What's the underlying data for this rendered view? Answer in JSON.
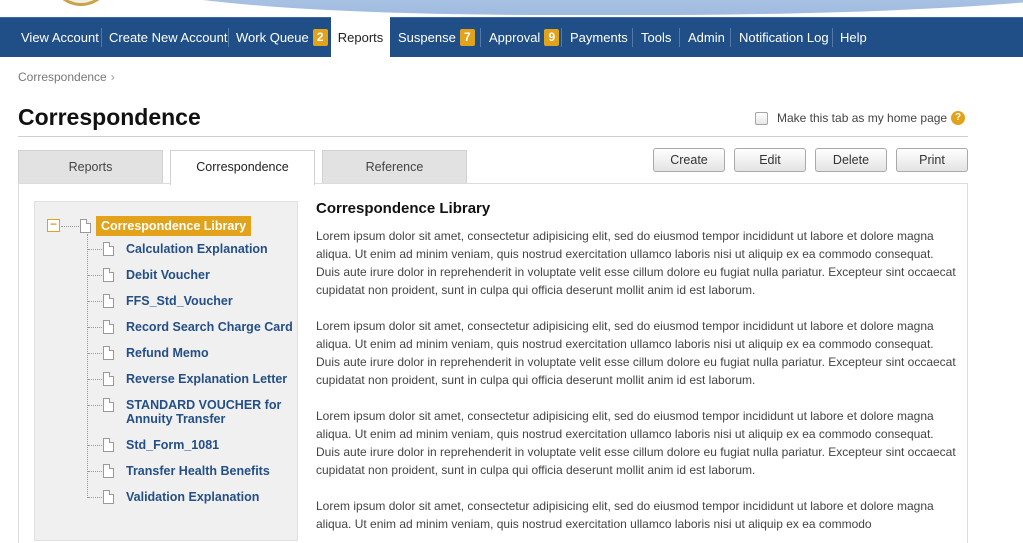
{
  "nav": {
    "items": [
      {
        "label": "View Account"
      },
      {
        "label": "Create New Account"
      },
      {
        "label": "Work Queue",
        "badge": "2"
      },
      {
        "label": "Reports"
      },
      {
        "label": "Suspense",
        "badge": "7"
      },
      {
        "label": "Approval",
        "badge": "9"
      },
      {
        "label": "Payments"
      },
      {
        "label": "Tools"
      },
      {
        "label": "Admin"
      },
      {
        "label": "Notification Log"
      },
      {
        "label": "Help"
      }
    ],
    "active": "Reports",
    "bar_color": "#1f4f86",
    "badge_color": "#e2a21a"
  },
  "breadcrumb": {
    "item": "Correspondence",
    "chevron": "›"
  },
  "page": {
    "title": "Correspondence",
    "home_toggle_label": "Make this tab as my home page",
    "help_icon": "question-circle-icon",
    "help_glyph": "?"
  },
  "tabs": [
    {
      "label": "Reports"
    },
    {
      "label": "Correspondence"
    },
    {
      "label": "Reference"
    }
  ],
  "active_tab": "Correspondence",
  "toolbar": {
    "create_label": "Create",
    "edit_label": "Edit",
    "delete_label": "Delete",
    "print_label": "Print"
  },
  "tree": {
    "collapse_glyph": "−",
    "root_label": "Correspondence Library",
    "items": [
      {
        "label": "Calculation Explanation"
      },
      {
        "label": "Debit Voucher"
      },
      {
        "label": "FFS_Std_Voucher"
      },
      {
        "label": "Record Search Charge Card"
      },
      {
        "label": "Refund Memo"
      },
      {
        "label": "Reverse Explanation Letter"
      },
      {
        "label": "STANDARD VOUCHER for Annuity Transfer"
      },
      {
        "label": "Std_Form_1081"
      },
      {
        "label": "Transfer Health Benefits"
      },
      {
        "label": "Validation Explanation"
      }
    ]
  },
  "article": {
    "title": "Correspondence Library",
    "paragraphs": [
      "Lorem ipsum dolor sit amet, consectetur adipisicing elit, sed do eiusmod tempor incididunt ut labore et dolore magna aliqua. Ut enim ad minim veniam, quis nostrud exercitation ullamco laboris nisi ut aliquip ex ea commodo consequat. Duis aute irure dolor in reprehenderit in voluptate velit esse cillum dolore eu fugiat nulla pariatur. Excepteur sint occaecat cupidatat non proident, sunt in culpa qui officia deserunt mollit anim id est laborum.",
      "Lorem ipsum dolor sit amet, consectetur adipisicing elit, sed do eiusmod tempor incididunt ut labore et dolore magna aliqua. Ut enim ad minim veniam, quis nostrud exercitation ullamco laboris nisi ut aliquip ex ea commodo consequat. Duis aute irure dolor in reprehenderit in voluptate velit esse cillum dolore eu fugiat nulla pariatur. Excepteur sint occaecat cupidatat non proident, sunt in culpa qui officia deserunt mollit anim id est laborum.",
      "Lorem ipsum dolor sit amet, consectetur adipisicing elit, sed do eiusmod tempor incididunt ut labore et dolore magna aliqua. Ut enim ad minim veniam, quis nostrud exercitation ullamco laboris nisi ut aliquip ex ea commodo consequat. Duis aute irure dolor in reprehenderit in voluptate velit esse cillum dolore eu fugiat nulla pariatur. Excepteur sint occaecat cupidatat non proident, sunt in culpa qui officia deserunt mollit anim id est laborum.",
      "Lorem ipsum dolor sit amet, consectetur adipisicing elit, sed do eiusmod tempor incididunt ut labore et dolore magna aliqua. Ut enim ad minim veniam, quis nostrud exercitation ullamco laboris nisi ut aliquip ex ea commodo"
    ]
  }
}
